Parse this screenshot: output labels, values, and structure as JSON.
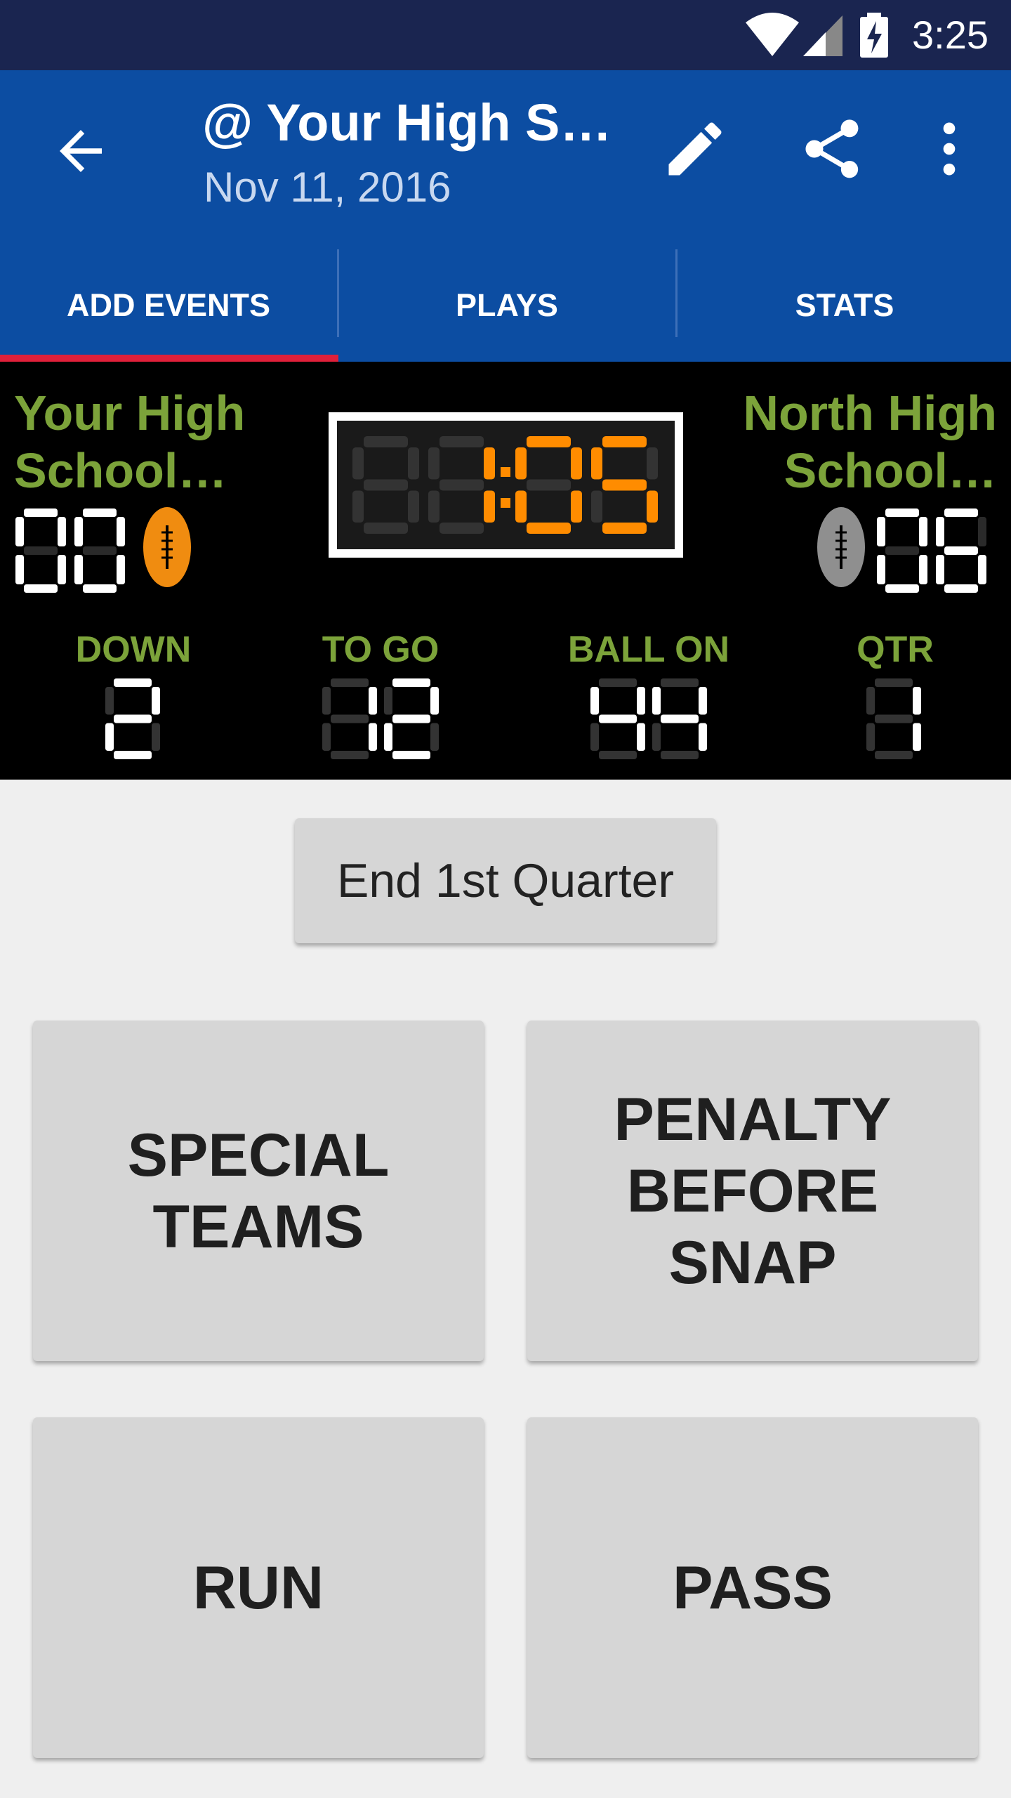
{
  "status_bar": {
    "time": "3:25"
  },
  "app_bar": {
    "title": "@ Your High S…",
    "subtitle": "Nov 11, 2016",
    "icons": [
      "back-arrow-icon",
      "pencil-icon",
      "share-icon",
      "more-vert-icon"
    ]
  },
  "tabs": [
    {
      "label": "ADD EVENTS",
      "selected": true
    },
    {
      "label": "PLAYS",
      "selected": false
    },
    {
      "label": "STATS",
      "selected": false
    }
  ],
  "scoreboard": {
    "home_team": {
      "line1": "Your High",
      "line2": "School…",
      "score": "0",
      "possession": true
    },
    "away_team": {
      "line1": "North High",
      "line2": "School…",
      "score": "6",
      "possession": false
    },
    "clock": "1:05",
    "down": {
      "label": "DOWN",
      "value": "2"
    },
    "to_go": {
      "label": "TO GO",
      "value": "12"
    },
    "ball_on": {
      "label": "BALL ON",
      "value": "44"
    },
    "quarter": {
      "label": "QTR",
      "value": "1"
    },
    "colors": {
      "team_text": "#7ca33a",
      "clock_digits": "#ff8c00",
      "dim_segment": "#333333"
    }
  },
  "actions": {
    "end_quarter": "End 1st Quarter",
    "special_teams": [
      "SPECIAL",
      "TEAMS"
    ],
    "penalty": [
      "PENALTY",
      "BEFORE",
      "SNAP"
    ],
    "run": "RUN",
    "pass": "PASS"
  }
}
